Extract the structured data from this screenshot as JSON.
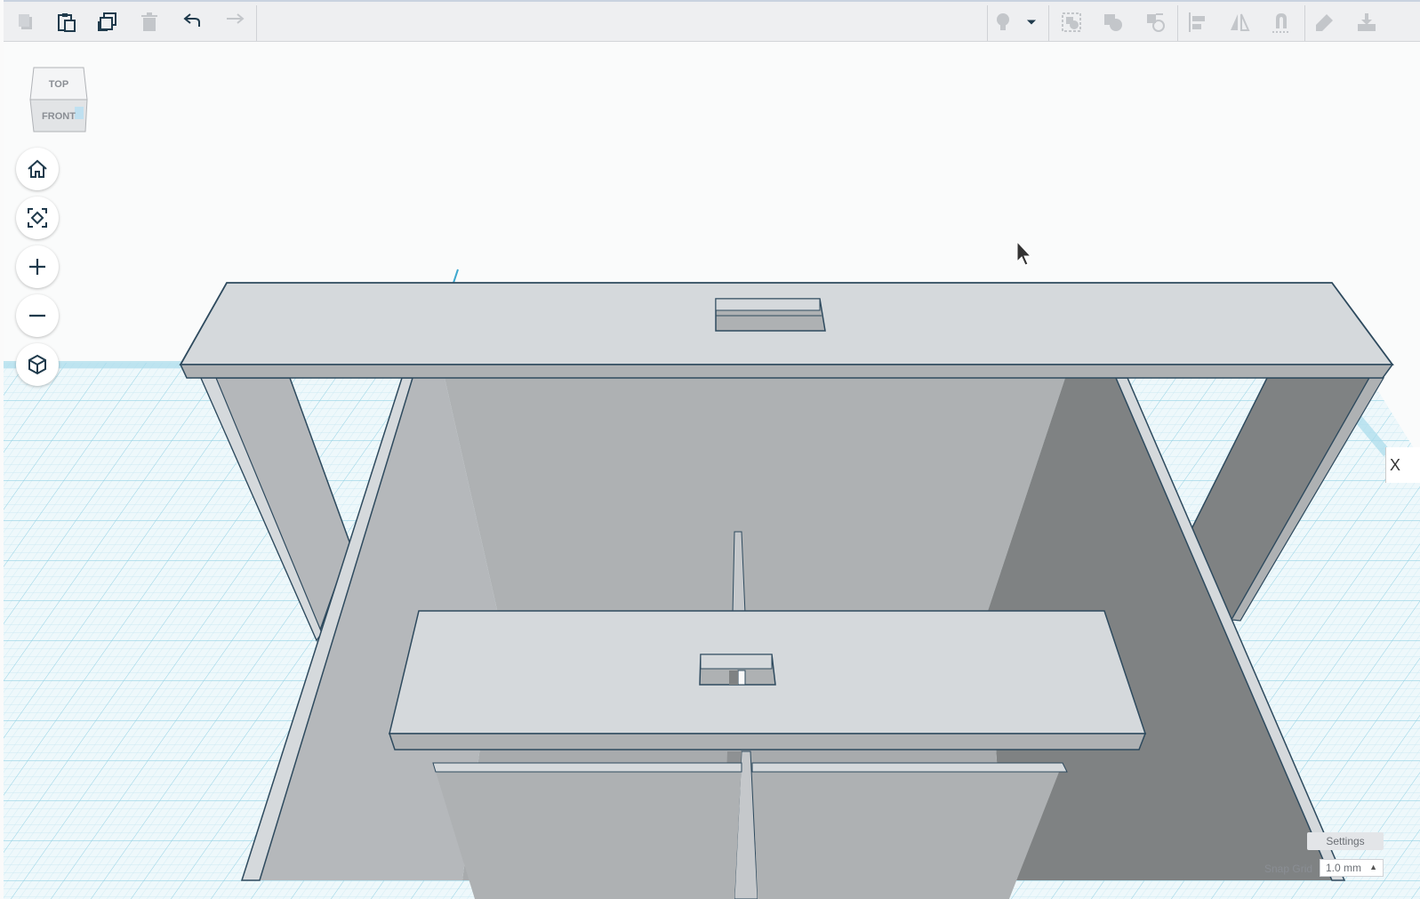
{
  "toolbar": {
    "left_tools": [
      "copy-icon",
      "paste-icon",
      "duplicate-icon",
      "delete-icon",
      "undo-icon",
      "redo-icon"
    ],
    "right_tools": [
      "light-bulb-icon",
      "dropdown-arrow-icon",
      "group-icon",
      "ungroup-icon",
      "cruise-icon",
      "align-icon",
      "mirror-icon",
      "workplane-magnet-icon",
      "note-icon",
      "import-icon"
    ]
  },
  "viewcube": {
    "top_label": "TOP",
    "front_label": "FRONT"
  },
  "nav": {
    "home": "home-icon",
    "fit": "fit-view-icon",
    "zoom_in": "zoom-in-icon",
    "zoom_out": "zoom-out-icon",
    "projection": "projection-cube-icon"
  },
  "footer": {
    "settings_label": "Settings",
    "snap_grid_label": "Snap Grid",
    "snap_grid_value": "1.0 mm"
  },
  "right_panel_toggle": "X",
  "colors": {
    "grid_line": "#9fd4e4",
    "grid_bg": "#e9f6fa",
    "shape_light": "#d5d9dc",
    "shape_mid": "#aeb1b3",
    "shape_dark": "#7f8283",
    "outline": "#2e4a5e",
    "accent": "#3ea8cf"
  }
}
